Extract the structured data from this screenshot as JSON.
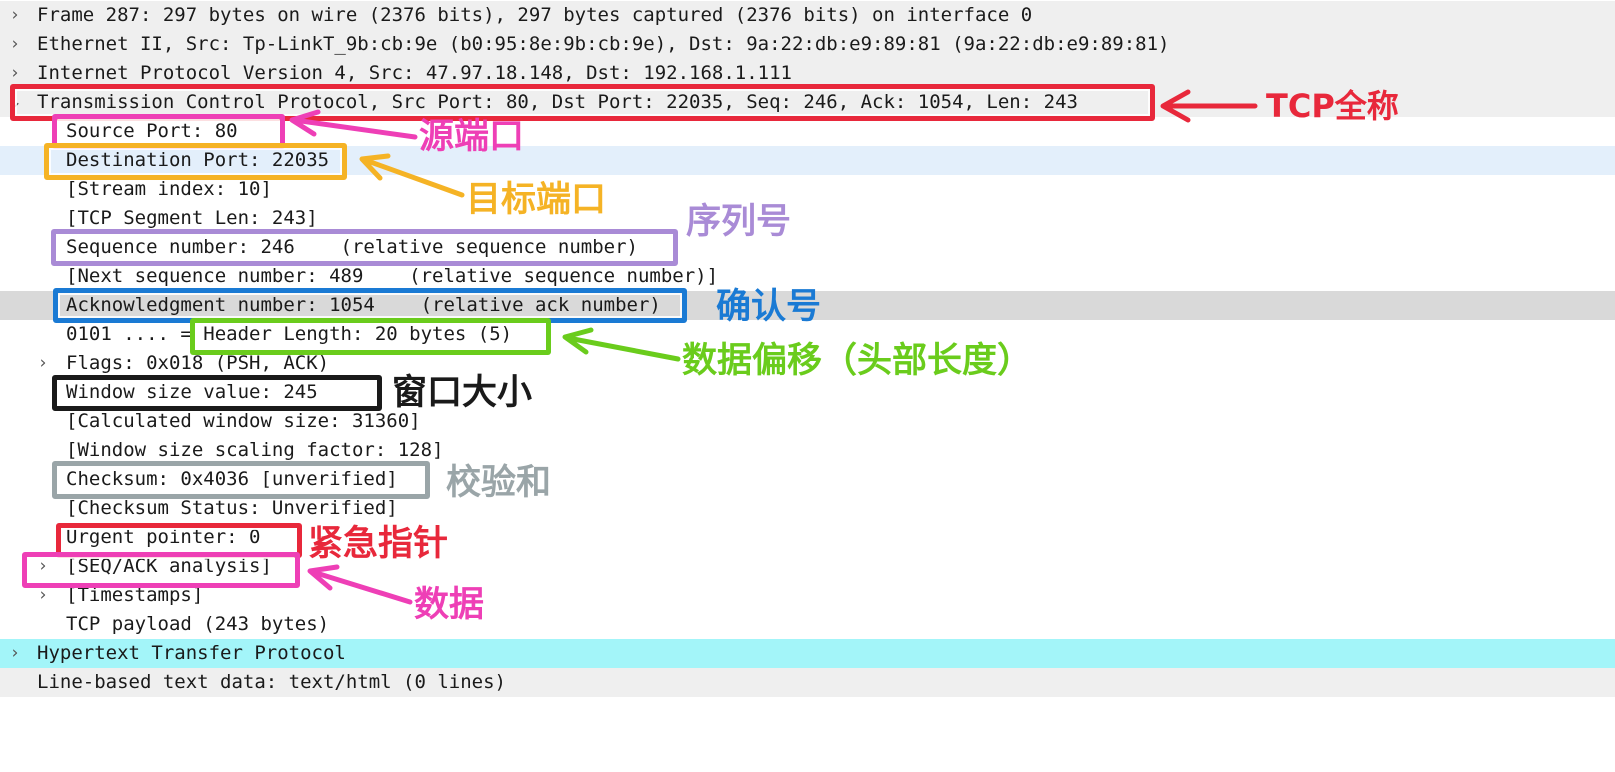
{
  "rows": [
    {
      "text": "Frame 287: 297 bytes on wire (2376 bits), 297 bytes captured (2376 bits) on interface 0",
      "chevron": true
    },
    {
      "text": "Ethernet II, Src: Tp-LinkT_9b:cb:9e (b0:95:8e:9b:cb:9e), Dst: 9a:22:db:e9:89:81 (9a:22:db:e9:89:81)",
      "chevron": true
    },
    {
      "text": "Internet Protocol Version 4, Src: 47.97.18.148, Dst: 192.168.1.111",
      "chevron": true
    },
    {
      "text": "Transmission Control Protocol, Src Port: 80, Dst Port: 22035, Seq: 246, Ack: 1054, Len: 243",
      "chevron": true
    },
    {
      "text": "Source Port: 80"
    },
    {
      "text": "Destination Port: 22035"
    },
    {
      "text": "[Stream index: 10]"
    },
    {
      "text": "[TCP Segment Len: 243]"
    },
    {
      "text": "Sequence number: 246    (relative sequence number)"
    },
    {
      "text": "[Next sequence number: 489    (relative sequence number)]"
    },
    {
      "text": "Acknowledgment number: 1054    (relative ack number)"
    },
    {
      "text": "0101 .... = Header Length: 20 bytes (5)"
    },
    {
      "text": "Flags: 0x018 (PSH, ACK)",
      "chevron": true
    },
    {
      "text": "Window size value: 245"
    },
    {
      "text": "[Calculated window size: 31360]"
    },
    {
      "text": "[Window size scaling factor: 128]"
    },
    {
      "text": "Checksum: 0x4036 [unverified]"
    },
    {
      "text": "[Checksum Status: Unverified]"
    },
    {
      "text": "Urgent pointer: 0"
    },
    {
      "text": "[SEQ/ACK analysis]",
      "chevron": true
    },
    {
      "text": "[Timestamps]",
      "chevron": true
    },
    {
      "text": "TCP payload (243 bytes)"
    },
    {
      "text": "Hypertext Transfer Protocol",
      "chevron": true
    },
    {
      "text": "Line-based text data: text/html (0 lines)"
    }
  ],
  "annotations": {
    "tcp_full_name": "TCP全称",
    "source_port": "源端口",
    "destination_port": "目标端口",
    "sequence_number": "序列号",
    "ack_number": "确认号",
    "data_offset": "数据偏移（头部长度）",
    "window_size": "窗口大小",
    "checksum": "校验和",
    "urgent_pointer": "紧急指针",
    "data": "数据"
  },
  "colors": {
    "red": "#e8283b",
    "magenta": "#ee3fb6",
    "orange": "#f5b325",
    "purple": "#a98bd6",
    "blue": "#1a7ad4",
    "green": "#6acc1c",
    "black": "#1a1a1a",
    "gray": "#9aa5a8",
    "row_gray": "#efefef",
    "row_selected_blue": "#e3effb",
    "row_dark_gray": "#d9d9d9",
    "row_cyan": "#a3f5f9"
  }
}
